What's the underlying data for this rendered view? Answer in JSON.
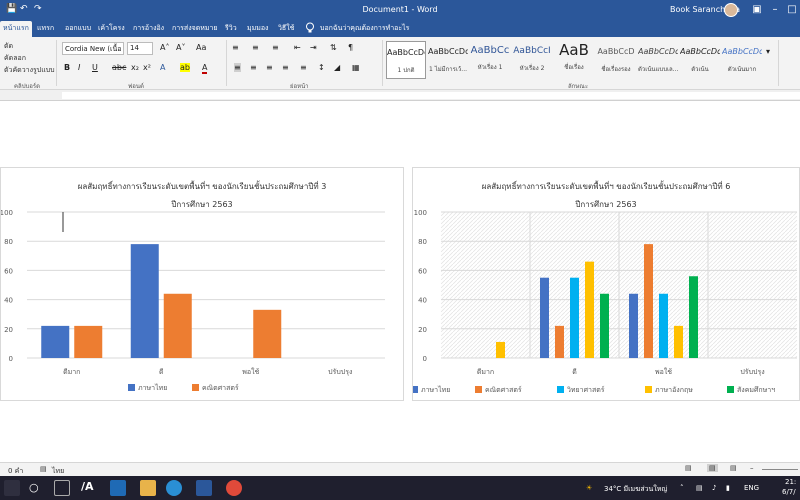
{
  "window": {
    "title": "Document1 - Word",
    "user": "Book Saranchana"
  },
  "tabs": [
    "หน้าแรก",
    "แทรก",
    "ออกแบบ",
    "เค้าโครง",
    "การอ้างอิง",
    "การส่งจดหมาย",
    "รีวิว",
    "มุมมอง",
    "วิธีใช้"
  ],
  "tell_me": "บอกฉันว่าคุณต้องการทำอะไร",
  "ribbon": {
    "clipboard": {
      "cut": "ตัด",
      "copy": "คัดลอก",
      "paste_format": "ตัวคัดวางรูปแบบ",
      "label": "คลิปบอร์ด"
    },
    "font": {
      "name": "Cordia New (เนื้อ",
      "size": "14",
      "label": "ฟอนต์"
    },
    "paragraph_label": "ย่อหน้า",
    "styles_label": "ลักษณะ",
    "styles": [
      {
        "sample": "AaBbCcDd",
        "name": "1 ปกติ"
      },
      {
        "sample": "AaBbCcDd",
        "name": "1 ไม่มีการเว้..."
      },
      {
        "sample": "AaBbCc",
        "name": "หัวเรื่อง 1"
      },
      {
        "sample": "AaBbCcI",
        "name": "หัวเรื่อง 2"
      },
      {
        "sample": "AaB",
        "name": "ชื่อเรื่อง"
      },
      {
        "sample": "AaBbCcD",
        "name": "ชื่อเรื่องรอง"
      },
      {
        "sample": "AaBbCcDd",
        "name": "ตัวเน้นแบบเล..."
      },
      {
        "sample": "AaBbCcDd",
        "name": "ตัวเน้น"
      },
      {
        "sample": "AaBbCcDd",
        "name": "ตัวเน้นมาก"
      }
    ]
  },
  "status": {
    "page": "0 คำ",
    "language": "ไทย"
  },
  "taskbar": {
    "weather": "34°C มีเมฆส่วนใหญ่",
    "time": "21:",
    "date": "6/7/"
  },
  "chart_data": [
    {
      "type": "bar",
      "title": "ผลสัมฤทธิ์ทางการเรียนระดับเขตพื้นที่ฯ ของนักเรียนชั้นประถมศึกษาปีที่ 3",
      "subtitle": "ปีการศึกษา 2563",
      "categories": [
        "ดีมาก",
        "ดี",
        "พอใช้",
        "ปรับปรุง"
      ],
      "ylim": [
        0,
        100
      ],
      "yticks": [
        0,
        20,
        40,
        60,
        80,
        100
      ],
      "legend": "bottom",
      "series": [
        {
          "name": "ภาษาไทย",
          "color": "#4472c4",
          "values": [
            22,
            78,
            0,
            0
          ]
        },
        {
          "name": "คณิตศาสตร์",
          "color": "#ed7d31",
          "values": [
            22,
            44,
            33,
            0
          ]
        }
      ]
    },
    {
      "type": "bar",
      "title": "ผลสัมฤทธิ์ทางการเรียนระดับเขตพื้นที่ฯ ของนักเรียนชั้นประถมศึกษาปีที่ 6",
      "subtitle": "ปีการศึกษา 2563",
      "categories": [
        "ดีมาก",
        "ดี",
        "พอใช้",
        "ปรับปรุง"
      ],
      "ylim": [
        0,
        100
      ],
      "yticks": [
        0,
        20,
        40,
        60,
        80,
        100
      ],
      "legend": "bottom",
      "series": [
        {
          "name": "ภาษาไทย",
          "color": "#4472c4",
          "values": [
            0,
            55,
            44,
            0
          ]
        },
        {
          "name": "คณิตศาสตร์",
          "color": "#ed7d31",
          "values": [
            0,
            22,
            78,
            0
          ]
        },
        {
          "name": "วิทยาศาสตร์",
          "color": "#00b0f0",
          "values": [
            0,
            55,
            44,
            0
          ]
        },
        {
          "name": "ภาษาอังกฤษ",
          "color": "#ffc000",
          "values": [
            11,
            66,
            22,
            0
          ]
        },
        {
          "name": "สังคมศึกษาฯ",
          "color": "#00b050",
          "values": [
            0,
            44,
            56,
            0
          ]
        }
      ]
    }
  ]
}
